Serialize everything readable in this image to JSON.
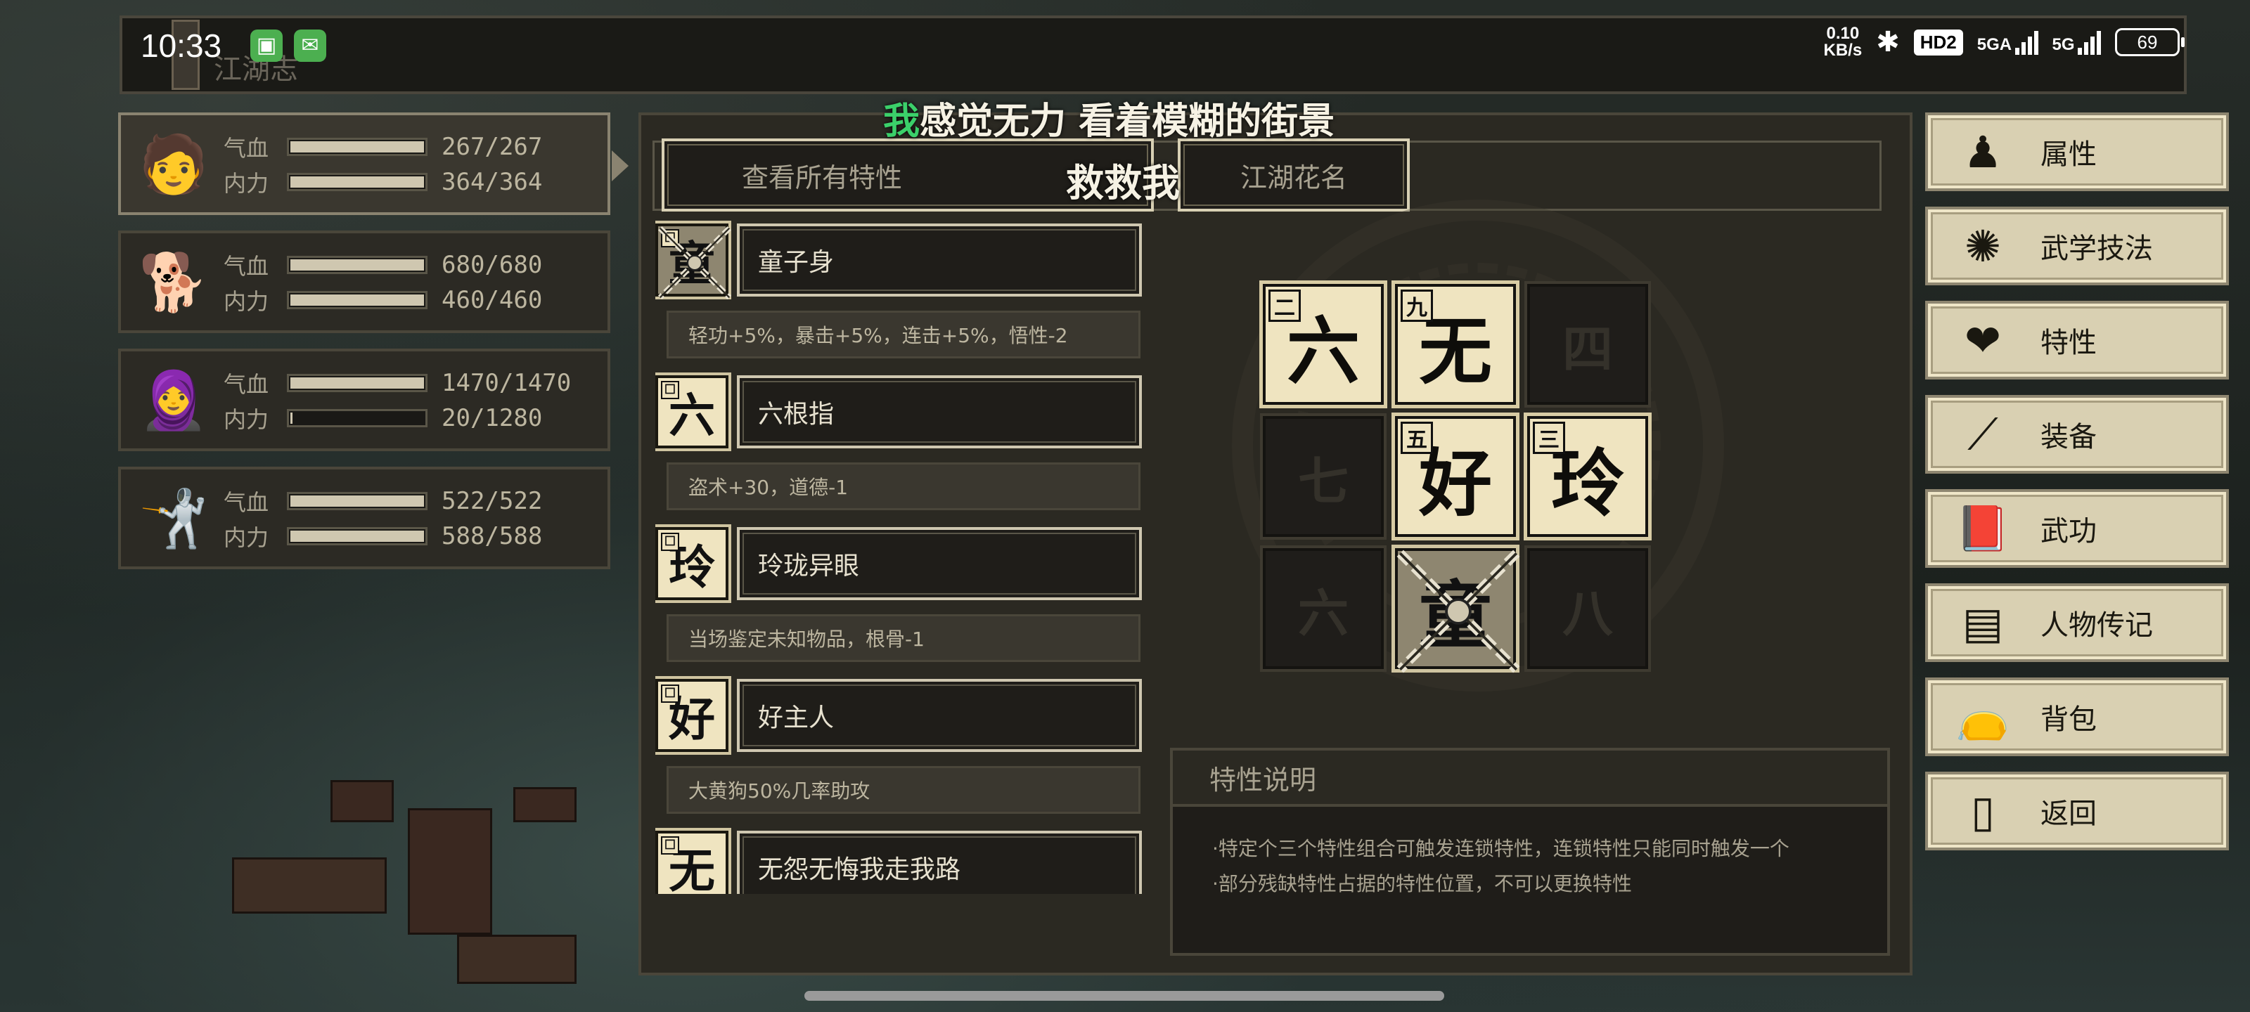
{
  "status": {
    "time": "10:33",
    "net_speed_value": "0.10",
    "net_speed_unit": "KB/s",
    "hd": "HD2",
    "sig1": "5GA",
    "sig2": "5G",
    "battery": "69",
    "icons": [
      "android-icon",
      "wechat-icon",
      "bluetooth-icon"
    ]
  },
  "location": "江湖志",
  "party": [
    {
      "name_icon": "swordsman-avatar",
      "hp_label": "气血",
      "hp": "267/267",
      "hp_frac": 1.0,
      "mp_label": "内力",
      "mp": "364/364",
      "mp_frac": 1.0,
      "active": true
    },
    {
      "name_icon": "dog-avatar",
      "hp_label": "气血",
      "hp": "680/680",
      "hp_frac": 1.0,
      "mp_label": "内力",
      "mp": "460/460",
      "mp_frac": 1.0,
      "active": false
    },
    {
      "name_icon": "monk-avatar",
      "hp_label": "气血",
      "hp": "1470/1470",
      "hp_frac": 1.0,
      "mp_label": "内力",
      "mp": "20/1280",
      "mp_frac": 0.016,
      "active": false
    },
    {
      "name_icon": "fighter-avatar",
      "hp_label": "气血",
      "hp": "522/522",
      "hp_frac": 1.0,
      "mp_label": "内力",
      "mp": "588/588",
      "mp_frac": 1.0,
      "active": false
    }
  ],
  "lyrics": {
    "line1_first": "我",
    "line1_rest": "感觉无力 看着模糊的街景",
    "line2": "救救我"
  },
  "tabs": {
    "all_traits": "查看所有特性",
    "nickname": "江湖花名"
  },
  "traits": [
    {
      "glyph": "童",
      "mini": "",
      "broken": true,
      "name": "童子身",
      "desc": "轻功+5%，暴击+5%，连击+5%，悟性-2"
    },
    {
      "glyph": "六",
      "mini": "",
      "broken": false,
      "name": "六根指",
      "desc": "盗术+30，道德-1"
    },
    {
      "glyph": "玲",
      "mini": "",
      "broken": false,
      "name": "玲珑异眼",
      "desc": "当场鉴定未知物品，根骨-1"
    },
    {
      "glyph": "好",
      "mini": "",
      "broken": false,
      "name": "好主人",
      "desc": "大黄狗50%几率助攻"
    },
    {
      "glyph": "无",
      "mini": "",
      "broken": false,
      "name": "无怨无悔我走我路",
      "desc": ""
    }
  ],
  "grid": [
    {
      "tag": "二",
      "char": "六",
      "state": "filled"
    },
    {
      "tag": "九",
      "char": "无",
      "state": "filled"
    },
    {
      "tag": "",
      "char": "四",
      "state": "empty"
    },
    {
      "tag": "",
      "char": "七",
      "state": "empty"
    },
    {
      "tag": "五",
      "char": "好",
      "state": "filled"
    },
    {
      "tag": "三",
      "char": "玲",
      "state": "filled"
    },
    {
      "tag": "",
      "char": "六",
      "state": "empty"
    },
    {
      "tag": "",
      "char": "童",
      "state": "broken"
    },
    {
      "tag": "",
      "char": "八",
      "state": "empty"
    }
  ],
  "description": {
    "title": "特性说明",
    "lines": [
      "·特定个三个特性组合可触发连锁特性，连锁特性只能同时触发一个",
      "·部分残缺特性占据的特性位置，不可以更换特性"
    ]
  },
  "menu": [
    {
      "label": "属性",
      "icon": "person-icon"
    },
    {
      "label": "武学技法",
      "icon": "martial-skill-icon"
    },
    {
      "label": "特性",
      "icon": "trait-heart-icon"
    },
    {
      "label": "装备",
      "icon": "sword-icon"
    },
    {
      "label": "武功",
      "icon": "book-icon"
    },
    {
      "label": "人物传记",
      "icon": "scroll-icon"
    },
    {
      "label": "背包",
      "icon": "bag-icon"
    },
    {
      "label": "返回",
      "icon": "door-icon"
    }
  ]
}
